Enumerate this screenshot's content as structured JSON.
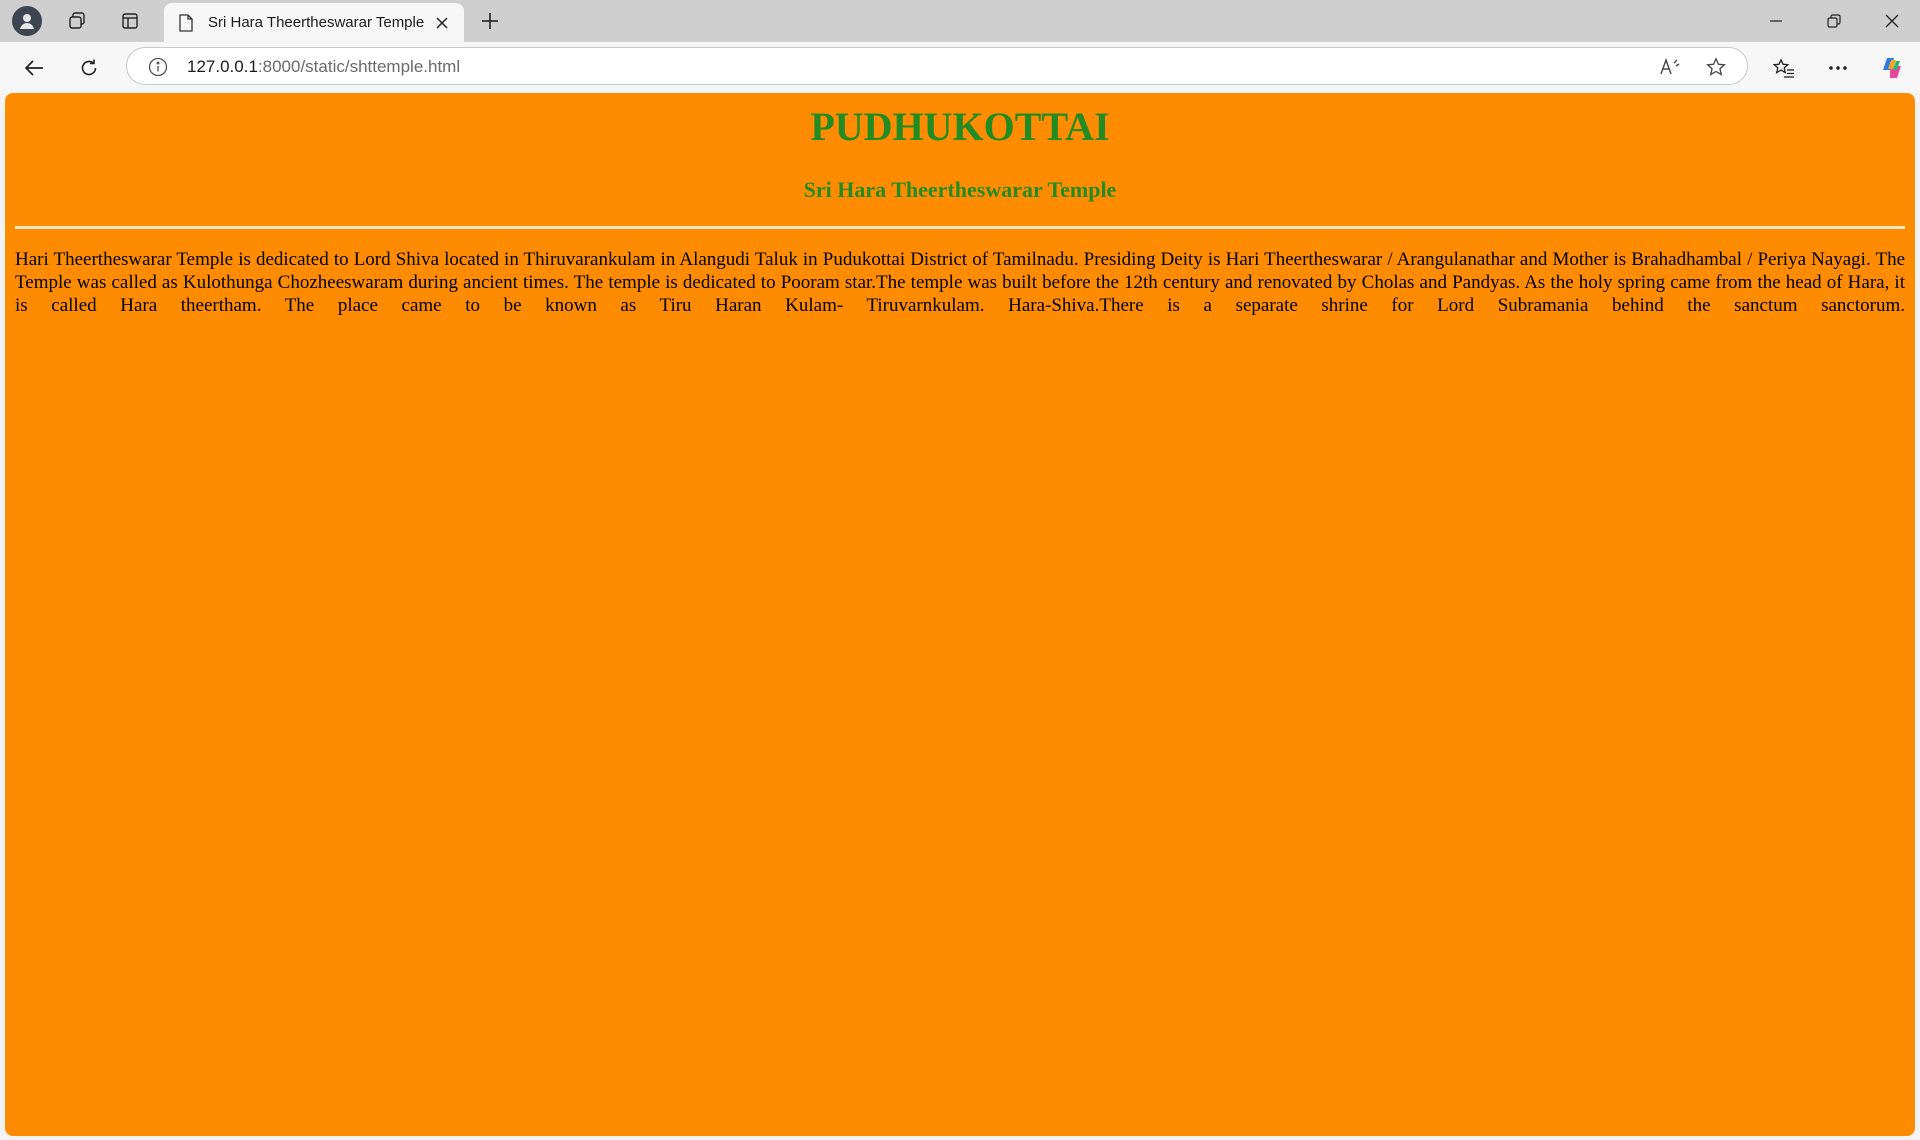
{
  "browser": {
    "tab": {
      "title": "Sri Hara Theertheswarar Temple"
    },
    "address": {
      "host": "127.0.0.1",
      "rest": ":8000/static/shttemple.html"
    },
    "icons": {
      "profile": "profile-avatar-icon",
      "workspaces": "workspaces-icon",
      "tab_actions": "vertical-tabs-icon",
      "page": "page-icon",
      "close_tab": "close-icon",
      "new_tab": "plus-icon",
      "minimize": "minimize-icon",
      "restore": "restore-icon",
      "close_window": "close-icon",
      "back": "back-arrow-icon",
      "refresh": "refresh-icon",
      "site_info": "info-icon",
      "read_aloud": "read-aloud-icon",
      "favorite": "star-icon",
      "favorites": "favorites-icon",
      "more": "more-icon",
      "copilot": "copilot-icon"
    }
  },
  "page": {
    "background": "#ff8c00",
    "heading_color": "#228b22",
    "heading": "PUDHUKOTTAI",
    "subheading": "Sri Hara Theertheswarar Temple",
    "paragraph": "Hari Theertheswarar Temple is dedicated to Lord Shiva located in Thiruvarankulam in Alangudi Taluk in Pudukottai District of Tamilnadu. Presiding Deity is Hari Theertheswarar / Arangulanathar and Mother is Brahadhambal / Periya Nayagi. The Temple was called as Kulothunga Chozheeswaram during ancient times. The temple is dedicated to Pooram star.The temple was built before the 12th century and renovated by Cholas and Pandyas. As the holy spring came from the head of Hara, it is called Hara theertham. The place came to be known as Tiru Haran Kulam- Tiruvarnkulam. Hara-Shiva.There is a separate shrine for Lord Subramania behind the sanctum sanctorum."
  }
}
